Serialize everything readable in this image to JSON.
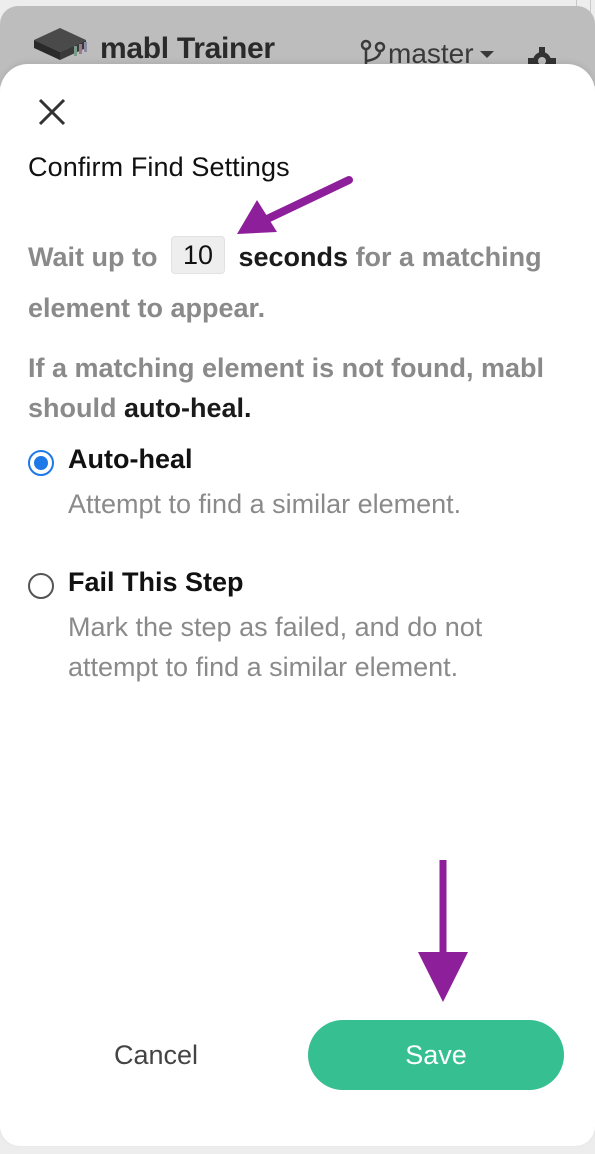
{
  "header": {
    "app_title": "mabl Trainer",
    "branch": "master",
    "icons": [
      "mabl-logo-icon",
      "git-branch-icon",
      "chevron-down-icon",
      "gear-icon"
    ]
  },
  "dialog": {
    "title": "Confirm Find Settings",
    "wait": {
      "prefix": "Wait up to",
      "seconds_value": "10",
      "unit": "seconds",
      "suffix": "for a matching element to appear."
    },
    "not_found": {
      "prefix": "If a matching element is not found, mabl should",
      "choice": "auto-heal."
    },
    "options": [
      {
        "label": "Auto-heal",
        "description": "Attempt to find a similar element.",
        "selected": true
      },
      {
        "label": "Fail This Step",
        "description": "Mark the step as failed, and do not attempt to find a similar element.",
        "selected": false
      }
    ],
    "cancel_label": "Cancel",
    "save_label": "Save"
  },
  "colors": {
    "accent_green": "#36bf90",
    "radio_blue": "#1e78e8",
    "annotation_purple": "#8e1f9a"
  }
}
